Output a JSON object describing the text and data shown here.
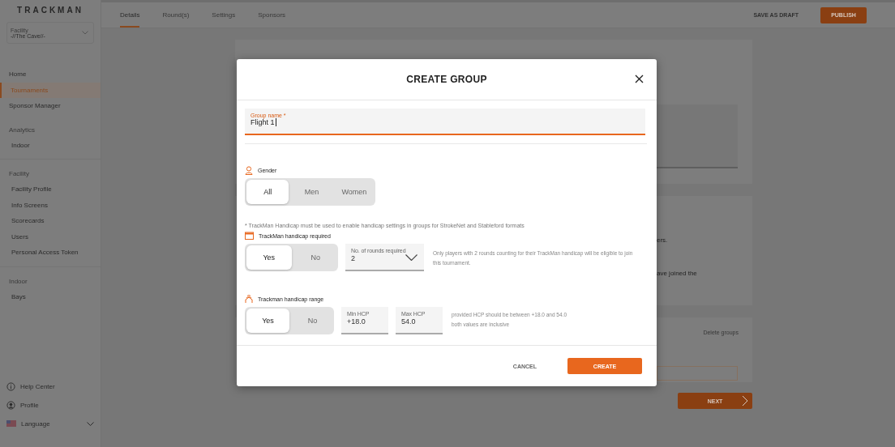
{
  "sidebar": {
    "logo": "TRACKMAN",
    "facility": {
      "label": "Facility",
      "value": "-//The Cave//-"
    },
    "groups": [
      {
        "items": [
          {
            "label": "Home",
            "selected": false
          },
          {
            "label": "Tournaments",
            "selected": true
          },
          {
            "label": "Sponsor Manager",
            "selected": false
          }
        ]
      },
      {
        "heading": "Analytics",
        "items": [
          {
            "label": "Indoor",
            "selected": false
          }
        ]
      },
      {
        "heading": "Facility",
        "items": [
          {
            "label": "Facility Profile",
            "selected": false
          },
          {
            "label": "Info Screens",
            "selected": false
          },
          {
            "label": "Scorecards",
            "selected": false
          },
          {
            "label": "Users",
            "selected": false
          },
          {
            "label": "Personal Access Token",
            "selected": false
          }
        ]
      },
      {
        "heading": "Indoor",
        "items": [
          {
            "label": "Bays",
            "selected": false
          }
        ]
      }
    ],
    "footer": [
      {
        "kind": "info",
        "label": "Help Center"
      },
      {
        "kind": "profile",
        "label": "Profile"
      },
      {
        "kind": "language",
        "label": "Language"
      }
    ]
  },
  "tabs": [
    {
      "label": "Details",
      "selected": true
    },
    {
      "label": "Round(s)",
      "selected": false
    },
    {
      "label": "Settings",
      "selected": false
    },
    {
      "label": "Sponsors",
      "selected": false
    }
  ],
  "actions": {
    "save_draft": "SAVE AS DRAFT",
    "publish": "PUBLISH"
  },
  "background": {
    "fragments": [
      "ers.",
      "ave joined the"
    ],
    "delete_groups": "Delete groups",
    "next": "NEXT"
  },
  "modal": {
    "title": "CREATE GROUP",
    "name_field": {
      "label": "Group name *",
      "value": "Flight 1"
    },
    "gender": {
      "label": "Gender",
      "options": [
        {
          "label": "All",
          "selected": true
        },
        {
          "label": "Men",
          "selected": false
        },
        {
          "label": "Women",
          "selected": false
        }
      ]
    },
    "note": "* TrackMan Handicap must be used to enable handicap settings in groups for StrokeNet and Stableford formats",
    "handicap_required": {
      "label": "TrackMan handicap required",
      "options": [
        {
          "label": "Yes",
          "selected": true
        },
        {
          "label": "No",
          "selected": false
        }
      ],
      "rounds_select": {
        "label": "No. of rounds required",
        "value": "2"
      },
      "hint": "Only players with 2 rounds counting for their TrackMan handicap will be eligible to join this tournament."
    },
    "handicap_range": {
      "label": "Trackman handicap range",
      "options": [
        {
          "label": "Yes",
          "selected": true
        },
        {
          "label": "No",
          "selected": false
        }
      ],
      "min": {
        "label": "Min HCP",
        "value": "+18.0"
      },
      "max": {
        "label": "Max HCP",
        "value": "54.0"
      },
      "hint": [
        "provided HCP should be between +18.0 and 54.0",
        "both values are inclusive"
      ]
    },
    "buttons": {
      "cancel": "CANCEL",
      "create": "CREATE"
    }
  }
}
